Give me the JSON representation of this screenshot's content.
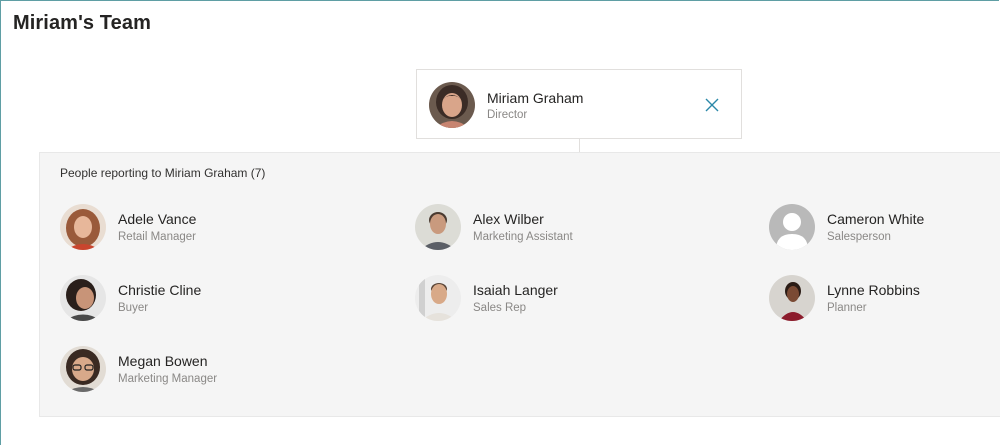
{
  "page": {
    "title": "Miriam's Team"
  },
  "manager": {
    "name": "Miriam Graham",
    "role": "Director",
    "avatar_icon": "person-photo",
    "close_icon": "close-icon"
  },
  "reports": {
    "heading": "People reporting to Miriam Graham (7)",
    "people": [
      {
        "name": "Adele Vance",
        "role": "Retail Manager"
      },
      {
        "name": "Alex Wilber",
        "role": "Marketing Assistant"
      },
      {
        "name": "Cameron White",
        "role": "Salesperson"
      },
      {
        "name": "Christie Cline",
        "role": "Buyer"
      },
      {
        "name": "Isaiah Langer",
        "role": "Sales Rep"
      },
      {
        "name": "Lynne Robbins",
        "role": "Planner"
      },
      {
        "name": "Megan Bowen",
        "role": "Marketing Manager"
      }
    ]
  },
  "colors": {
    "accent": "#2b88a8",
    "frame": "#5f9ea4",
    "panel": "#f5f5f5",
    "muted_text": "#8a8886"
  }
}
